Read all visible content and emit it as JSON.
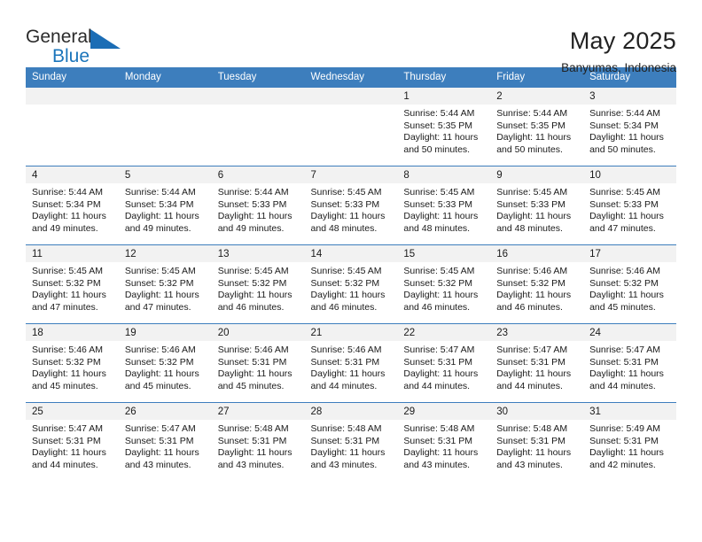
{
  "brand": {
    "name_part1": "General",
    "name_part2": "Blue",
    "logo_icon": "triangle-logo-icon"
  },
  "header": {
    "month_title": "May 2025",
    "location": "Banyumas, Indonesia"
  },
  "colors": {
    "header_blue": "#3d7ebd",
    "brand_blue": "#1b75bb",
    "daynum_band": "#f2f2f2",
    "text": "#1a1a1a"
  },
  "calendar": {
    "weekday_headers": [
      "Sunday",
      "Monday",
      "Tuesday",
      "Wednesday",
      "Thursday",
      "Friday",
      "Saturday"
    ],
    "weeks": [
      [
        {
          "day": "",
          "empty": true,
          "sunrise": "",
          "sunset": "",
          "daylight1": "",
          "daylight2": ""
        },
        {
          "day": "",
          "empty": true,
          "sunrise": "",
          "sunset": "",
          "daylight1": "",
          "daylight2": ""
        },
        {
          "day": "",
          "empty": true,
          "sunrise": "",
          "sunset": "",
          "daylight1": "",
          "daylight2": ""
        },
        {
          "day": "",
          "empty": true,
          "sunrise": "",
          "sunset": "",
          "daylight1": "",
          "daylight2": ""
        },
        {
          "day": "1",
          "empty": false,
          "sunrise": "Sunrise: 5:44 AM",
          "sunset": "Sunset: 5:35 PM",
          "daylight1": "Daylight: 11 hours",
          "daylight2": "and 50 minutes."
        },
        {
          "day": "2",
          "empty": false,
          "sunrise": "Sunrise: 5:44 AM",
          "sunset": "Sunset: 5:35 PM",
          "daylight1": "Daylight: 11 hours",
          "daylight2": "and 50 minutes."
        },
        {
          "day": "3",
          "empty": false,
          "sunrise": "Sunrise: 5:44 AM",
          "sunset": "Sunset: 5:34 PM",
          "daylight1": "Daylight: 11 hours",
          "daylight2": "and 50 minutes."
        }
      ],
      [
        {
          "day": "4",
          "empty": false,
          "sunrise": "Sunrise: 5:44 AM",
          "sunset": "Sunset: 5:34 PM",
          "daylight1": "Daylight: 11 hours",
          "daylight2": "and 49 minutes."
        },
        {
          "day": "5",
          "empty": false,
          "sunrise": "Sunrise: 5:44 AM",
          "sunset": "Sunset: 5:34 PM",
          "daylight1": "Daylight: 11 hours",
          "daylight2": "and 49 minutes."
        },
        {
          "day": "6",
          "empty": false,
          "sunrise": "Sunrise: 5:44 AM",
          "sunset": "Sunset: 5:33 PM",
          "daylight1": "Daylight: 11 hours",
          "daylight2": "and 49 minutes."
        },
        {
          "day": "7",
          "empty": false,
          "sunrise": "Sunrise: 5:45 AM",
          "sunset": "Sunset: 5:33 PM",
          "daylight1": "Daylight: 11 hours",
          "daylight2": "and 48 minutes."
        },
        {
          "day": "8",
          "empty": false,
          "sunrise": "Sunrise: 5:45 AM",
          "sunset": "Sunset: 5:33 PM",
          "daylight1": "Daylight: 11 hours",
          "daylight2": "and 48 minutes."
        },
        {
          "day": "9",
          "empty": false,
          "sunrise": "Sunrise: 5:45 AM",
          "sunset": "Sunset: 5:33 PM",
          "daylight1": "Daylight: 11 hours",
          "daylight2": "and 48 minutes."
        },
        {
          "day": "10",
          "empty": false,
          "sunrise": "Sunrise: 5:45 AM",
          "sunset": "Sunset: 5:33 PM",
          "daylight1": "Daylight: 11 hours",
          "daylight2": "and 47 minutes."
        }
      ],
      [
        {
          "day": "11",
          "empty": false,
          "sunrise": "Sunrise: 5:45 AM",
          "sunset": "Sunset: 5:32 PM",
          "daylight1": "Daylight: 11 hours",
          "daylight2": "and 47 minutes."
        },
        {
          "day": "12",
          "empty": false,
          "sunrise": "Sunrise: 5:45 AM",
          "sunset": "Sunset: 5:32 PM",
          "daylight1": "Daylight: 11 hours",
          "daylight2": "and 47 minutes."
        },
        {
          "day": "13",
          "empty": false,
          "sunrise": "Sunrise: 5:45 AM",
          "sunset": "Sunset: 5:32 PM",
          "daylight1": "Daylight: 11 hours",
          "daylight2": "and 46 minutes."
        },
        {
          "day": "14",
          "empty": false,
          "sunrise": "Sunrise: 5:45 AM",
          "sunset": "Sunset: 5:32 PM",
          "daylight1": "Daylight: 11 hours",
          "daylight2": "and 46 minutes."
        },
        {
          "day": "15",
          "empty": false,
          "sunrise": "Sunrise: 5:45 AM",
          "sunset": "Sunset: 5:32 PM",
          "daylight1": "Daylight: 11 hours",
          "daylight2": "and 46 minutes."
        },
        {
          "day": "16",
          "empty": false,
          "sunrise": "Sunrise: 5:46 AM",
          "sunset": "Sunset: 5:32 PM",
          "daylight1": "Daylight: 11 hours",
          "daylight2": "and 46 minutes."
        },
        {
          "day": "17",
          "empty": false,
          "sunrise": "Sunrise: 5:46 AM",
          "sunset": "Sunset: 5:32 PM",
          "daylight1": "Daylight: 11 hours",
          "daylight2": "and 45 minutes."
        }
      ],
      [
        {
          "day": "18",
          "empty": false,
          "sunrise": "Sunrise: 5:46 AM",
          "sunset": "Sunset: 5:32 PM",
          "daylight1": "Daylight: 11 hours",
          "daylight2": "and 45 minutes."
        },
        {
          "day": "19",
          "empty": false,
          "sunrise": "Sunrise: 5:46 AM",
          "sunset": "Sunset: 5:32 PM",
          "daylight1": "Daylight: 11 hours",
          "daylight2": "and 45 minutes."
        },
        {
          "day": "20",
          "empty": false,
          "sunrise": "Sunrise: 5:46 AM",
          "sunset": "Sunset: 5:31 PM",
          "daylight1": "Daylight: 11 hours",
          "daylight2": "and 45 minutes."
        },
        {
          "day": "21",
          "empty": false,
          "sunrise": "Sunrise: 5:46 AM",
          "sunset": "Sunset: 5:31 PM",
          "daylight1": "Daylight: 11 hours",
          "daylight2": "and 44 minutes."
        },
        {
          "day": "22",
          "empty": false,
          "sunrise": "Sunrise: 5:47 AM",
          "sunset": "Sunset: 5:31 PM",
          "daylight1": "Daylight: 11 hours",
          "daylight2": "and 44 minutes."
        },
        {
          "day": "23",
          "empty": false,
          "sunrise": "Sunrise: 5:47 AM",
          "sunset": "Sunset: 5:31 PM",
          "daylight1": "Daylight: 11 hours",
          "daylight2": "and 44 minutes."
        },
        {
          "day": "24",
          "empty": false,
          "sunrise": "Sunrise: 5:47 AM",
          "sunset": "Sunset: 5:31 PM",
          "daylight1": "Daylight: 11 hours",
          "daylight2": "and 44 minutes."
        }
      ],
      [
        {
          "day": "25",
          "empty": false,
          "sunrise": "Sunrise: 5:47 AM",
          "sunset": "Sunset: 5:31 PM",
          "daylight1": "Daylight: 11 hours",
          "daylight2": "and 44 minutes."
        },
        {
          "day": "26",
          "empty": false,
          "sunrise": "Sunrise: 5:47 AM",
          "sunset": "Sunset: 5:31 PM",
          "daylight1": "Daylight: 11 hours",
          "daylight2": "and 43 minutes."
        },
        {
          "day": "27",
          "empty": false,
          "sunrise": "Sunrise: 5:48 AM",
          "sunset": "Sunset: 5:31 PM",
          "daylight1": "Daylight: 11 hours",
          "daylight2": "and 43 minutes."
        },
        {
          "day": "28",
          "empty": false,
          "sunrise": "Sunrise: 5:48 AM",
          "sunset": "Sunset: 5:31 PM",
          "daylight1": "Daylight: 11 hours",
          "daylight2": "and 43 minutes."
        },
        {
          "day": "29",
          "empty": false,
          "sunrise": "Sunrise: 5:48 AM",
          "sunset": "Sunset: 5:31 PM",
          "daylight1": "Daylight: 11 hours",
          "daylight2": "and 43 minutes."
        },
        {
          "day": "30",
          "empty": false,
          "sunrise": "Sunrise: 5:48 AM",
          "sunset": "Sunset: 5:31 PM",
          "daylight1": "Daylight: 11 hours",
          "daylight2": "and 43 minutes."
        },
        {
          "day": "31",
          "empty": false,
          "sunrise": "Sunrise: 5:49 AM",
          "sunset": "Sunset: 5:31 PM",
          "daylight1": "Daylight: 11 hours",
          "daylight2": "and 42 minutes."
        }
      ]
    ]
  }
}
